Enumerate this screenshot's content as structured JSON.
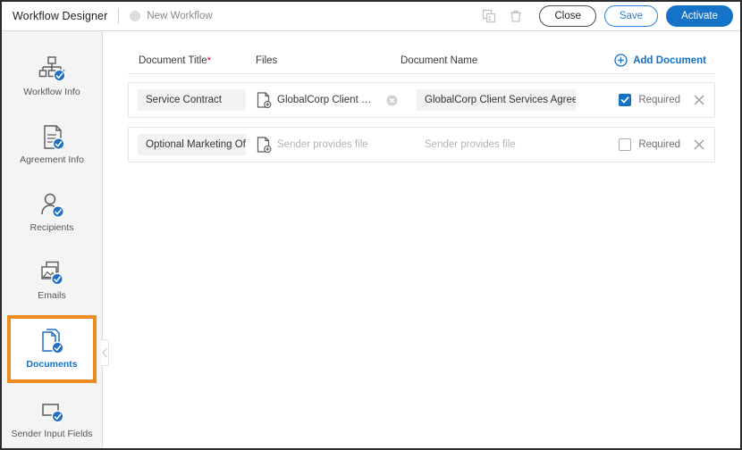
{
  "header": {
    "app_title": "Workflow Designer",
    "workflow_name": "New Workflow",
    "status_dot_color": "#dcdcdc",
    "icons": {
      "copy": "copy-icon",
      "delete": "trash-icon"
    },
    "buttons": {
      "close": "Close",
      "save": "Save",
      "activate": "Activate"
    }
  },
  "sidebar": {
    "items": [
      {
        "label": "Workflow Info",
        "icon": "workflow-info-icon",
        "active": false
      },
      {
        "label": "Agreement Info",
        "icon": "agreement-info-icon",
        "active": false
      },
      {
        "label": "Recipients",
        "icon": "recipients-icon",
        "active": false
      },
      {
        "label": "Emails",
        "icon": "emails-icon",
        "active": false
      },
      {
        "label": "Documents",
        "icon": "documents-icon",
        "active": true
      },
      {
        "label": "Sender Input Fields",
        "icon": "sender-input-fields-icon",
        "active": false
      }
    ],
    "active_highlight_color": "#ee8b1e",
    "active_text_color": "#1473c6"
  },
  "main": {
    "columns": {
      "document_title": "Document Title",
      "document_title_required_mark": "*",
      "files": "Files",
      "document_name": "Document Name"
    },
    "add_document_label": "Add Document",
    "accent_color": "#1473c6",
    "rows": [
      {
        "title": "Service Contract",
        "file_name": "GlobalCorp Client Servic...",
        "file_is_placeholder": false,
        "has_clear": true,
        "document_name": "GlobalCorp Client Services Agreement",
        "document_name_is_placeholder": false,
        "required_label": "Required",
        "required_checked": true
      },
      {
        "title": "Optional Marketing Offer",
        "file_name": "Sender provides file",
        "file_is_placeholder": true,
        "has_clear": false,
        "document_name": "Sender provides file",
        "document_name_is_placeholder": true,
        "required_label": "Required",
        "required_checked": false
      }
    ]
  }
}
